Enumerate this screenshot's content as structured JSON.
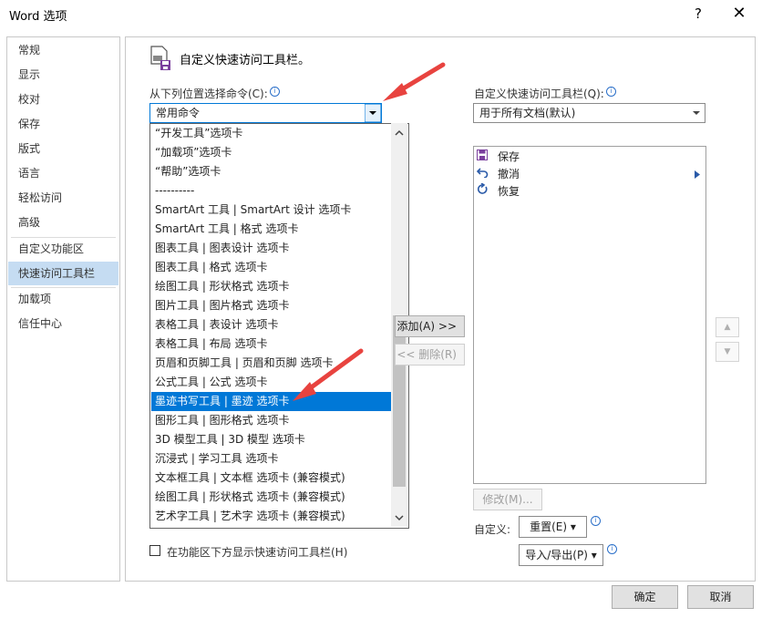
{
  "window": {
    "title": "Word 选项",
    "help": "?",
    "close": "✕"
  },
  "nav": {
    "items": [
      "常规",
      "显示",
      "校对",
      "保存",
      "版式",
      "语言",
      "轻松访问",
      "高级",
      "自定义功能区",
      "快速访问工具栏",
      "加载项",
      "信任中心"
    ],
    "selected": "快速访问工具栏"
  },
  "header": {
    "title": "自定义快速访问工具栏。",
    "icon": "quick-access-toolbar-icon"
  },
  "left": {
    "choose_label": "从下列位置选择命令(C):",
    "choose_value": "常用命令",
    "dropdown_items": [
      "“开发工具”选项卡",
      "“加载项”选项卡",
      "“帮助”选项卡",
      "----------",
      "SmartArt 工具 | SmartArt 设计 选项卡",
      "SmartArt 工具 | 格式 选项卡",
      "图表工具 | 图表设计 选项卡",
      "图表工具 | 格式 选项卡",
      "绘图工具 | 形状格式 选项卡",
      "图片工具 | 图片格式 选项卡",
      "表格工具 | 表设计 选项卡",
      "表格工具 | 布局 选项卡",
      "页眉和页脚工具 | 页眉和页脚 选项卡",
      "公式工具 | 公式 选项卡",
      "墨迹书写工具 | 墨迹 选项卡",
      "图形工具 | 图形格式  选项卡",
      "3D 模型工具 | 3D 模型 选项卡",
      "沉浸式 | 学习工具 选项卡",
      "文本框工具 | 文本框 选项卡 (兼容模式)",
      "绘图工具 | 形状格式 选项卡 (兼容模式)",
      "艺术字工具 | 艺术字 选项卡 (兼容模式)"
    ],
    "highlighted": "墨迹书写工具 | 墨迹 选项卡"
  },
  "middle": {
    "add_label": "添加(A) >>",
    "remove_label": "<< 删除(R)"
  },
  "right": {
    "customize_label": "自定义快速访问工具栏(Q):",
    "customize_value": "用于所有文档(默认)",
    "items": [
      {
        "label": "保存",
        "icon": "save-icon"
      },
      {
        "label": "撤消",
        "icon": "undo-icon"
      },
      {
        "label": "恢复",
        "icon": "redo-icon"
      }
    ],
    "modify_label": "修改(M)...",
    "customize_text": "自定义:",
    "reset_label": "重置(E) ▾",
    "import_export_label": "导入/导出(P) ▾"
  },
  "checkbox": {
    "label": "在功能区下方显示快速访问工具栏(H)",
    "checked": false
  },
  "footer": {
    "ok": "确定",
    "cancel": "取消"
  }
}
